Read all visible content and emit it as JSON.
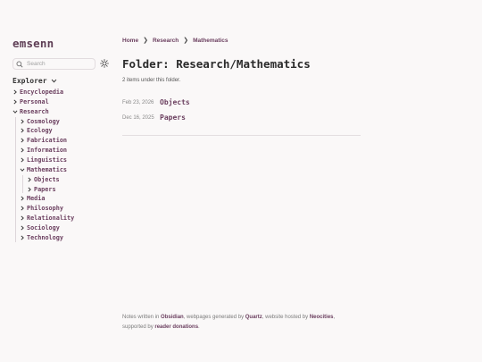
{
  "site": {
    "title": "emsenn"
  },
  "search": {
    "placeholder": "Search"
  },
  "explorer": {
    "label": "Explorer",
    "items": [
      {
        "label": "Encyclopedia",
        "depth": 0,
        "expanded": false
      },
      {
        "label": "Personal",
        "depth": 0,
        "expanded": false
      },
      {
        "label": "Research",
        "depth": 0,
        "expanded": true
      },
      {
        "label": "Cosmology",
        "depth": 1,
        "expanded": false
      },
      {
        "label": "Ecology",
        "depth": 1,
        "expanded": false
      },
      {
        "label": "Fabrication",
        "depth": 1,
        "expanded": false
      },
      {
        "label": "Information",
        "depth": 1,
        "expanded": false
      },
      {
        "label": "Linguistics",
        "depth": 1,
        "expanded": false
      },
      {
        "label": "Mathematics",
        "depth": 1,
        "expanded": true
      },
      {
        "label": "Objects",
        "depth": 2,
        "expanded": false
      },
      {
        "label": "Papers",
        "depth": 2,
        "expanded": false
      },
      {
        "label": "Media",
        "depth": 1,
        "expanded": false
      },
      {
        "label": "Philosophy",
        "depth": 1,
        "expanded": false
      },
      {
        "label": "Relationality",
        "depth": 1,
        "expanded": false
      },
      {
        "label": "Sociology",
        "depth": 1,
        "expanded": false
      },
      {
        "label": "Technology",
        "depth": 1,
        "expanded": false
      }
    ]
  },
  "breadcrumb": {
    "items": [
      "Home",
      "Research",
      "Mathematics"
    ],
    "separator": "❯"
  },
  "main": {
    "title": "Folder: Research/Mathematics",
    "count": "2 items under this folder.",
    "entries": [
      {
        "date": "Feb 23, 2026",
        "title": "Objects"
      },
      {
        "date": "Dec 16, 2025",
        "title": "Papers"
      }
    ]
  },
  "footer": {
    "line1_a": "Notes written in ",
    "obsidian": "Obsidian",
    "line1_b": ", webpages generated by ",
    "quartz": "Quartz",
    "line1_c": ", website hosted by ",
    "neocities": "Neocities",
    "line1_d": ",",
    "line2_a": "supported by ",
    "donations": "reader donations",
    "line2_b": "."
  },
  "colors": {
    "accent": "#6b3f5f",
    "background": "#faf8f8",
    "title": "#5e3e55"
  }
}
